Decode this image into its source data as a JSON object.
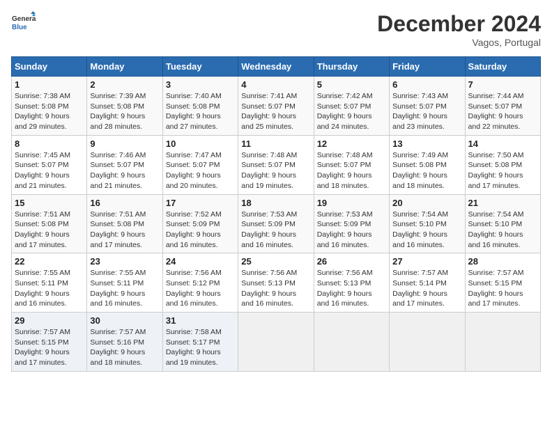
{
  "header": {
    "logo_line1": "General",
    "logo_line2": "Blue",
    "title": "December 2024",
    "subtitle": "Vagos, Portugal"
  },
  "weekdays": [
    "Sunday",
    "Monday",
    "Tuesday",
    "Wednesday",
    "Thursday",
    "Friday",
    "Saturday"
  ],
  "weeks": [
    [
      {
        "day": "1",
        "info": "Sunrise: 7:38 AM\nSunset: 5:08 PM\nDaylight: 9 hours\nand 29 minutes."
      },
      {
        "day": "2",
        "info": "Sunrise: 7:39 AM\nSunset: 5:08 PM\nDaylight: 9 hours\nand 28 minutes."
      },
      {
        "day": "3",
        "info": "Sunrise: 7:40 AM\nSunset: 5:08 PM\nDaylight: 9 hours\nand 27 minutes."
      },
      {
        "day": "4",
        "info": "Sunrise: 7:41 AM\nSunset: 5:07 PM\nDaylight: 9 hours\nand 25 minutes."
      },
      {
        "day": "5",
        "info": "Sunrise: 7:42 AM\nSunset: 5:07 PM\nDaylight: 9 hours\nand 24 minutes."
      },
      {
        "day": "6",
        "info": "Sunrise: 7:43 AM\nSunset: 5:07 PM\nDaylight: 9 hours\nand 23 minutes."
      },
      {
        "day": "7",
        "info": "Sunrise: 7:44 AM\nSunset: 5:07 PM\nDaylight: 9 hours\nand 22 minutes."
      }
    ],
    [
      {
        "day": "8",
        "info": "Sunrise: 7:45 AM\nSunset: 5:07 PM\nDaylight: 9 hours\nand 21 minutes."
      },
      {
        "day": "9",
        "info": "Sunrise: 7:46 AM\nSunset: 5:07 PM\nDaylight: 9 hours\nand 21 minutes."
      },
      {
        "day": "10",
        "info": "Sunrise: 7:47 AM\nSunset: 5:07 PM\nDaylight: 9 hours\nand 20 minutes."
      },
      {
        "day": "11",
        "info": "Sunrise: 7:48 AM\nSunset: 5:07 PM\nDaylight: 9 hours\nand 19 minutes."
      },
      {
        "day": "12",
        "info": "Sunrise: 7:48 AM\nSunset: 5:07 PM\nDaylight: 9 hours\nand 18 minutes."
      },
      {
        "day": "13",
        "info": "Sunrise: 7:49 AM\nSunset: 5:08 PM\nDaylight: 9 hours\nand 18 minutes."
      },
      {
        "day": "14",
        "info": "Sunrise: 7:50 AM\nSunset: 5:08 PM\nDaylight: 9 hours\nand 17 minutes."
      }
    ],
    [
      {
        "day": "15",
        "info": "Sunrise: 7:51 AM\nSunset: 5:08 PM\nDaylight: 9 hours\nand 17 minutes."
      },
      {
        "day": "16",
        "info": "Sunrise: 7:51 AM\nSunset: 5:08 PM\nDaylight: 9 hours\nand 17 minutes."
      },
      {
        "day": "17",
        "info": "Sunrise: 7:52 AM\nSunset: 5:09 PM\nDaylight: 9 hours\nand 16 minutes."
      },
      {
        "day": "18",
        "info": "Sunrise: 7:53 AM\nSunset: 5:09 PM\nDaylight: 9 hours\nand 16 minutes."
      },
      {
        "day": "19",
        "info": "Sunrise: 7:53 AM\nSunset: 5:09 PM\nDaylight: 9 hours\nand 16 minutes."
      },
      {
        "day": "20",
        "info": "Sunrise: 7:54 AM\nSunset: 5:10 PM\nDaylight: 9 hours\nand 16 minutes."
      },
      {
        "day": "21",
        "info": "Sunrise: 7:54 AM\nSunset: 5:10 PM\nDaylight: 9 hours\nand 16 minutes."
      }
    ],
    [
      {
        "day": "22",
        "info": "Sunrise: 7:55 AM\nSunset: 5:11 PM\nDaylight: 9 hours\nand 16 minutes."
      },
      {
        "day": "23",
        "info": "Sunrise: 7:55 AM\nSunset: 5:11 PM\nDaylight: 9 hours\nand 16 minutes."
      },
      {
        "day": "24",
        "info": "Sunrise: 7:56 AM\nSunset: 5:12 PM\nDaylight: 9 hours\nand 16 minutes."
      },
      {
        "day": "25",
        "info": "Sunrise: 7:56 AM\nSunset: 5:13 PM\nDaylight: 9 hours\nand 16 minutes."
      },
      {
        "day": "26",
        "info": "Sunrise: 7:56 AM\nSunset: 5:13 PM\nDaylight: 9 hours\nand 16 minutes."
      },
      {
        "day": "27",
        "info": "Sunrise: 7:57 AM\nSunset: 5:14 PM\nDaylight: 9 hours\nand 17 minutes."
      },
      {
        "day": "28",
        "info": "Sunrise: 7:57 AM\nSunset: 5:15 PM\nDaylight: 9 hours\nand 17 minutes."
      }
    ],
    [
      {
        "day": "29",
        "info": "Sunrise: 7:57 AM\nSunset: 5:15 PM\nDaylight: 9 hours\nand 17 minutes."
      },
      {
        "day": "30",
        "info": "Sunrise: 7:57 AM\nSunset: 5:16 PM\nDaylight: 9 hours\nand 18 minutes."
      },
      {
        "day": "31",
        "info": "Sunrise: 7:58 AM\nSunset: 5:17 PM\nDaylight: 9 hours\nand 19 minutes."
      },
      {
        "day": "",
        "info": ""
      },
      {
        "day": "",
        "info": ""
      },
      {
        "day": "",
        "info": ""
      },
      {
        "day": "",
        "info": ""
      }
    ]
  ]
}
